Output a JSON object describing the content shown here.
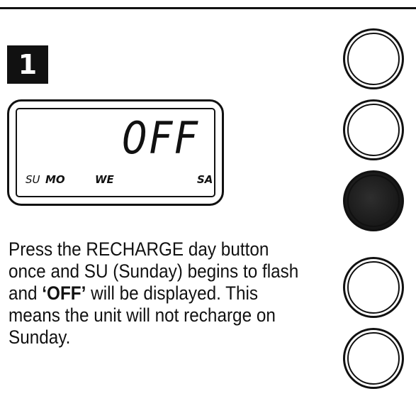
{
  "step": {
    "number": "1"
  },
  "display": {
    "value": "0FF",
    "days": {
      "su": "SU",
      "mo": "MO",
      "we": "WE",
      "sa": "SA"
    }
  },
  "instruction": {
    "text_before": "Press the RECHARGE day button once and SU (Sunday) begins to flash and ",
    "emphasis": "‘OFF’",
    "text_after": " will be displayed. This means the unit will not recharge on Sunday."
  },
  "buttons": [
    {
      "state": "unpressed"
    },
    {
      "state": "unpressed"
    },
    {
      "state": "pressed",
      "fill_color": "#1a1a1a"
    },
    {
      "state": "unpressed"
    },
    {
      "state": "unpressed"
    }
  ],
  "colors": {
    "ink": "#111111",
    "paper": "#ffffff"
  }
}
